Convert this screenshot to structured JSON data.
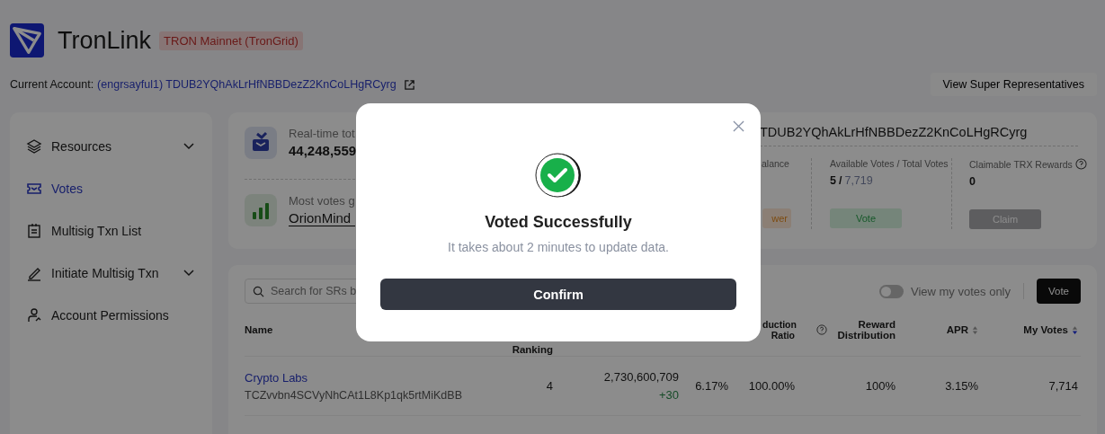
{
  "header": {
    "app_name": "TronLink",
    "network": "TRON Mainnet (TronGrid)",
    "account_label": "Current Account:",
    "account": "(engrsayful1) TDUB2YQhAkLrHfNBBDezZ2KnCoLHgRCyrg"
  },
  "view_sr_button": "View Super Representatives",
  "sidebar": {
    "items": [
      {
        "label": "Resources",
        "selected": false,
        "expandable": true
      },
      {
        "label": "Votes",
        "selected": true,
        "expandable": false
      },
      {
        "label": "Multisig Txn List",
        "selected": false,
        "expandable": false
      },
      {
        "label": "Initiate Multisig Txn",
        "selected": false,
        "expandable": true
      },
      {
        "label": "Account Permissions",
        "selected": false,
        "expandable": false
      }
    ]
  },
  "overview": {
    "stats": [
      {
        "label": "Real-time tot",
        "value": "44,248,559",
        "link": false
      },
      {
        "label": "Most votes g",
        "value": "OrionMind",
        "link": true
      }
    ],
    "address": "TDUB2YQhAkLrHfNBBDezZ2KnCoLHgRCyrg",
    "columns": [
      {
        "label": "alance",
        "help": false,
        "button": "wer",
        "kind": "warning"
      },
      {
        "label": "Available Votes / Total Votes",
        "help": false,
        "value": "5",
        "separator": "/",
        "total": "7,719",
        "button": "Vote",
        "kind": "success"
      },
      {
        "label": "Claimable TRX Rewards",
        "help": true,
        "value": "0",
        "button": "Claim",
        "kind": "muted"
      }
    ]
  },
  "list": {
    "search": {
      "placeholder": "Search for SRs b"
    },
    "toggle": {
      "label": "View my votes only",
      "on": false
    },
    "vote_button": "Vote",
    "columns": [
      {
        "label": "Name",
        "sortable": false,
        "help": false
      },
      {
        "label": "Ranking",
        "sortable": false,
        "help": false
      },
      {
        "label": "duction Ratio",
        "sortable": false
      },
      {
        "label": "Reward Distribution",
        "sortable": false,
        "help": true
      },
      {
        "label": "APR",
        "sortable": true,
        "sorted": false,
        "help": false
      },
      {
        "label": "My Votes",
        "sortable": true,
        "sorted": true,
        "help": false
      }
    ],
    "rows": [
      {
        "name": "Crypto Labs",
        "address": "TCZvvbn4SCVyNhCAt1L8Kp1qk5rtMiKdBB",
        "ranking": "4",
        "votes": "2,730,600,709",
        "change": "+30",
        "column_4": "6.17%",
        "ratio": "100.00%",
        "reward": "100%",
        "apr": "3.15%",
        "my_votes": "7,714"
      }
    ]
  },
  "modal": {
    "title": "Voted Successfully",
    "message": "It takes about 2 minutes to update data.",
    "confirm": "Confirm"
  }
}
